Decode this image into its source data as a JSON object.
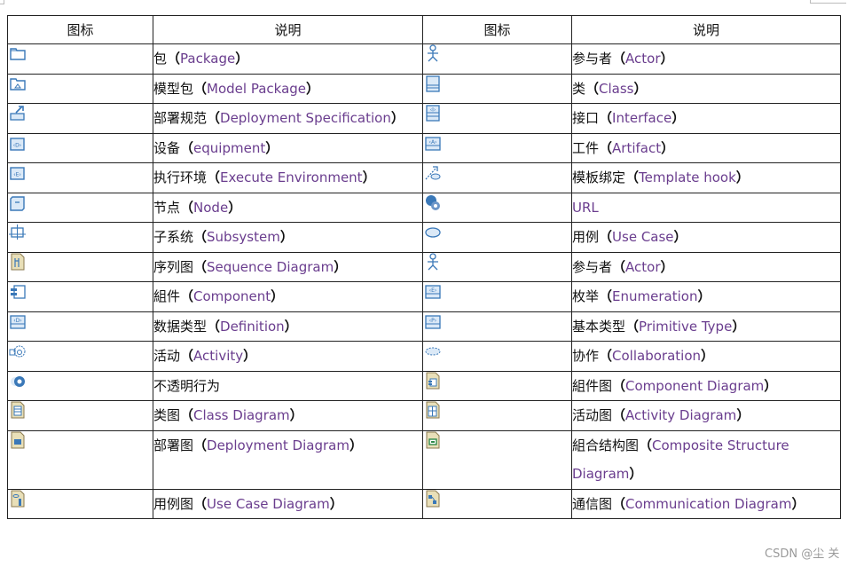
{
  "header": {
    "icon_col": "图标",
    "desc_col": "说明"
  },
  "rows": [
    {
      "left": {
        "icon": "package-icon",
        "zh": "包",
        "en": "Package"
      },
      "right": {
        "icon": "actor-icon",
        "zh": "参与者",
        "en": "Actor"
      }
    },
    {
      "left": {
        "icon": "model-package-icon",
        "zh": "模型包",
        "en": "Model Package"
      },
      "right": {
        "icon": "class-icon",
        "zh": "类",
        "en": "Class"
      }
    },
    {
      "left": {
        "icon": "deployment-specification-icon",
        "zh": "部署规范",
        "en": "Deployment Specification"
      },
      "right": {
        "icon": "interface-icon",
        "zh": "接口",
        "en": "Interface"
      }
    },
    {
      "left": {
        "icon": "device-icon",
        "zh": "设备",
        "en": "equipment"
      },
      "right": {
        "icon": "artifact-icon",
        "zh": "工件",
        "en": "Artifact"
      }
    },
    {
      "left": {
        "icon": "execution-environment-icon",
        "zh": "执行环境",
        "en": "Execute Environment"
      },
      "right": {
        "icon": "template-binding-icon",
        "zh": "模板绑定",
        "en": "Template hook"
      }
    },
    {
      "left": {
        "icon": "node-icon",
        "zh": "节点",
        "en": "Node"
      },
      "right": {
        "icon": "url-icon",
        "zh": "",
        "en": "URL"
      }
    },
    {
      "left": {
        "icon": "subsystem-icon",
        "zh": "子系统",
        "en": "Subsystem"
      },
      "right": {
        "icon": "use-case-icon",
        "zh": "用例",
        "en": "Use Case"
      }
    },
    {
      "left": {
        "icon": "sequence-diagram-icon",
        "zh": "序列图",
        "en": "Sequence Diagram"
      },
      "right": {
        "icon": "actor-icon",
        "zh": "参与者",
        "en": "Actor"
      }
    },
    {
      "left": {
        "icon": "component-icon",
        "zh": "組件",
        "en": "Component"
      },
      "right": {
        "icon": "enumeration-icon",
        "zh": "枚举",
        "en": "Enumeration"
      }
    },
    {
      "left": {
        "icon": "data-type-icon",
        "zh": "数据类型",
        "en": "Definition"
      },
      "right": {
        "icon": "primitive-type-icon",
        "zh": "基本类型",
        "en": "Primitive Type"
      }
    },
    {
      "left": {
        "icon": "activity-icon",
        "zh": "活动",
        "en": "Activity"
      },
      "right": {
        "icon": "collaboration-icon",
        "zh": "协作",
        "en": "Collaboration"
      }
    },
    {
      "left": {
        "icon": "opaque-behavior-icon",
        "zh": "不透明行为",
        "en": ""
      },
      "right": {
        "icon": "component-diagram-icon",
        "zh": "組件图",
        "en": "Component Diagram"
      }
    },
    {
      "left": {
        "icon": "class-diagram-icon",
        "zh": "类图",
        "en": "Class Diagram"
      },
      "right": {
        "icon": "activity-diagram-icon",
        "zh": "活动图",
        "en": "Activity Diagram"
      }
    },
    {
      "left": {
        "icon": "deployment-diagram-icon",
        "zh": "部署图",
        "en": "Deployment Diagram"
      },
      "right": {
        "icon": "composite-structure-diagram-icon",
        "zh": "組合结构图",
        "en": "Composite Structure Diagram"
      }
    },
    {
      "left": {
        "icon": "use-case-diagram-icon",
        "zh": "用例图",
        "en": "Use Case Diagram"
      },
      "right": {
        "icon": "communication-diagram-icon",
        "zh": "通信图",
        "en": "Communication Diagram"
      }
    }
  ],
  "paren_open": "（",
  "paren_close": "）",
  "watermark": "CSDN @尘  关",
  "colors": {
    "icon_blue": "#3a78b8",
    "icon_fill": "#dbe9f7",
    "diagram_page": "#e8dfb8",
    "text_en": "#6a3d8e"
  }
}
